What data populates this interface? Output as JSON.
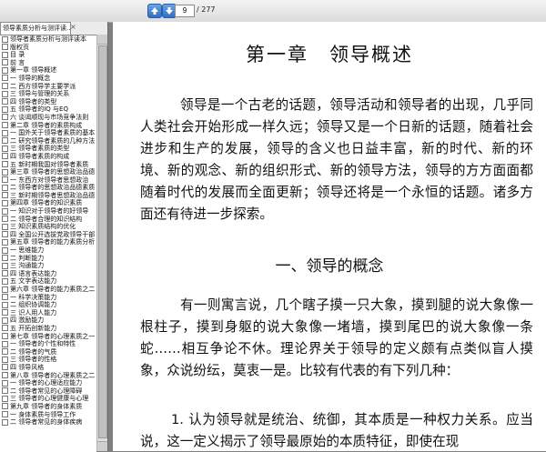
{
  "toolbar": {
    "current_page": "9",
    "total_pages": "/ 277"
  },
  "panel": {
    "tab_label": "领导素质分析与测评读..."
  },
  "bookmarks": [
    {
      "level": 0,
      "text": "领导者素质分析与测评读本"
    },
    {
      "level": 1,
      "text": "版权页"
    },
    {
      "level": 1,
      "text": "目 录"
    },
    {
      "level": 1,
      "text": "前 言"
    },
    {
      "level": 1,
      "text": "第一章 领导概述"
    },
    {
      "level": 2,
      "text": "一 领导的概念"
    },
    {
      "level": 2,
      "text": "二 西方领导学主要学派"
    },
    {
      "level": 2,
      "text": "三 领导与管理的关系"
    },
    {
      "level": 2,
      "text": "四 领导者的类型"
    },
    {
      "level": 2,
      "text": "五 领导者的IQ 与EQ"
    },
    {
      "level": 2,
      "text": "六 谈谒顺现与市场竞争法则"
    },
    {
      "level": 1,
      "text": "第二章 领导者的素质构成"
    },
    {
      "level": 2,
      "text": "一 国外关于领导者素质的基本"
    },
    {
      "level": 2,
      "text": "二 研究领导者素质的几种方法"
    },
    {
      "level": 2,
      "text": "三 领导者素质的类型"
    },
    {
      "level": 2,
      "text": "四 领导者素质的构成"
    },
    {
      "level": 2,
      "text": "五 新时期我国对领导者素质"
    },
    {
      "level": 1,
      "text": "第三章 领导者的思想政治品德"
    },
    {
      "level": 2,
      "text": "一 东西方对领导者思想政治"
    },
    {
      "level": 2,
      "text": "二 领导者的思想政治品德素质"
    },
    {
      "level": 2,
      "text": "三 新时期领导者思想政治品德"
    },
    {
      "level": 1,
      "text": "第四章 领导者的知识素质"
    },
    {
      "level": 2,
      "text": "一 知识对于领导者的好领导"
    },
    {
      "level": 2,
      "text": "二 领导者合理的知识结构"
    },
    {
      "level": 2,
      "text": "三 知识素质结构的优化"
    },
    {
      "level": 2,
      "text": "四 全国公开选拔党政领导干部"
    },
    {
      "level": 1,
      "text": "第五章 领导者的能力素质分析"
    },
    {
      "level": 2,
      "text": "一 思维能力"
    },
    {
      "level": 2,
      "text": "二 判断能力"
    },
    {
      "level": 2,
      "text": "三 沟通能力"
    },
    {
      "level": 2,
      "text": "四 语言表达能力"
    },
    {
      "level": 2,
      "text": "五 文字表达能力"
    },
    {
      "level": 1,
      "text": "第六章 领导者的能力素质之二"
    },
    {
      "level": 2,
      "text": "一 科学决策能力"
    },
    {
      "level": 2,
      "text": "二 组织协调能力"
    },
    {
      "level": 2,
      "text": "三 识人用人能力"
    },
    {
      "level": 2,
      "text": "四 激励能力"
    },
    {
      "level": 2,
      "text": "五 开拓创新能力"
    },
    {
      "level": 1,
      "text": "第七章 领导者的心理素质之一"
    },
    {
      "level": 2,
      "text": "一 领导者的个性和特性"
    },
    {
      "level": 2,
      "text": "二 领导者的气质"
    },
    {
      "level": 2,
      "text": "三 领导者的性格"
    },
    {
      "level": 2,
      "text": "四 领导风格"
    },
    {
      "level": 1,
      "text": "第八章 领导者的心理素质之二"
    },
    {
      "level": 2,
      "text": "一 领导者的心理适应能力"
    },
    {
      "level": 2,
      "text": "二 领导者常见的心理障碍"
    },
    {
      "level": 2,
      "text": "三 领导者的心理健康与心理"
    },
    {
      "level": 1,
      "text": "第九章 领导者的身体素质"
    },
    {
      "level": 2,
      "text": "一 身体素质与领导工作"
    },
    {
      "level": 2,
      "text": "二 领导者常见的身体疾病"
    }
  ],
  "document": {
    "chapter_title": "第一章　领导概述",
    "para1": "领导是一个古老的话题，领导活动和领导者的出现，几乎同人类社会开始形成一样久远；领导又是一个日新的话题，随着社会进步和生产的发展，领导的含义也日益丰富，新的时代、新的环境、新的观念、新的组织形式、新的领导方法，领导的方方面面都随着时代的发展而全面更新；领导还将是一个永恒的话题。诸多方面还有待进一步探索。",
    "section_title": "一、领导的概念",
    "para2": "有一则寓言说，几个瞎子摸一只大象，摸到腿的说大象像一根柱子，摸到身躯的说大象像一堵墙，摸到尾巴的说大象像一条蛇……相互争论不休。理论界关于领导的定义颇有点类似盲人摸象，众说纷纭，莫衷一是。比较有代表的有下列几种：",
    "item1_num": "1.",
    "item1_text": "认为领导就是统治、统御，其本质是一种权力关系。应当说，这一定义揭示了领导最原始的本质特征，即使在现"
  }
}
